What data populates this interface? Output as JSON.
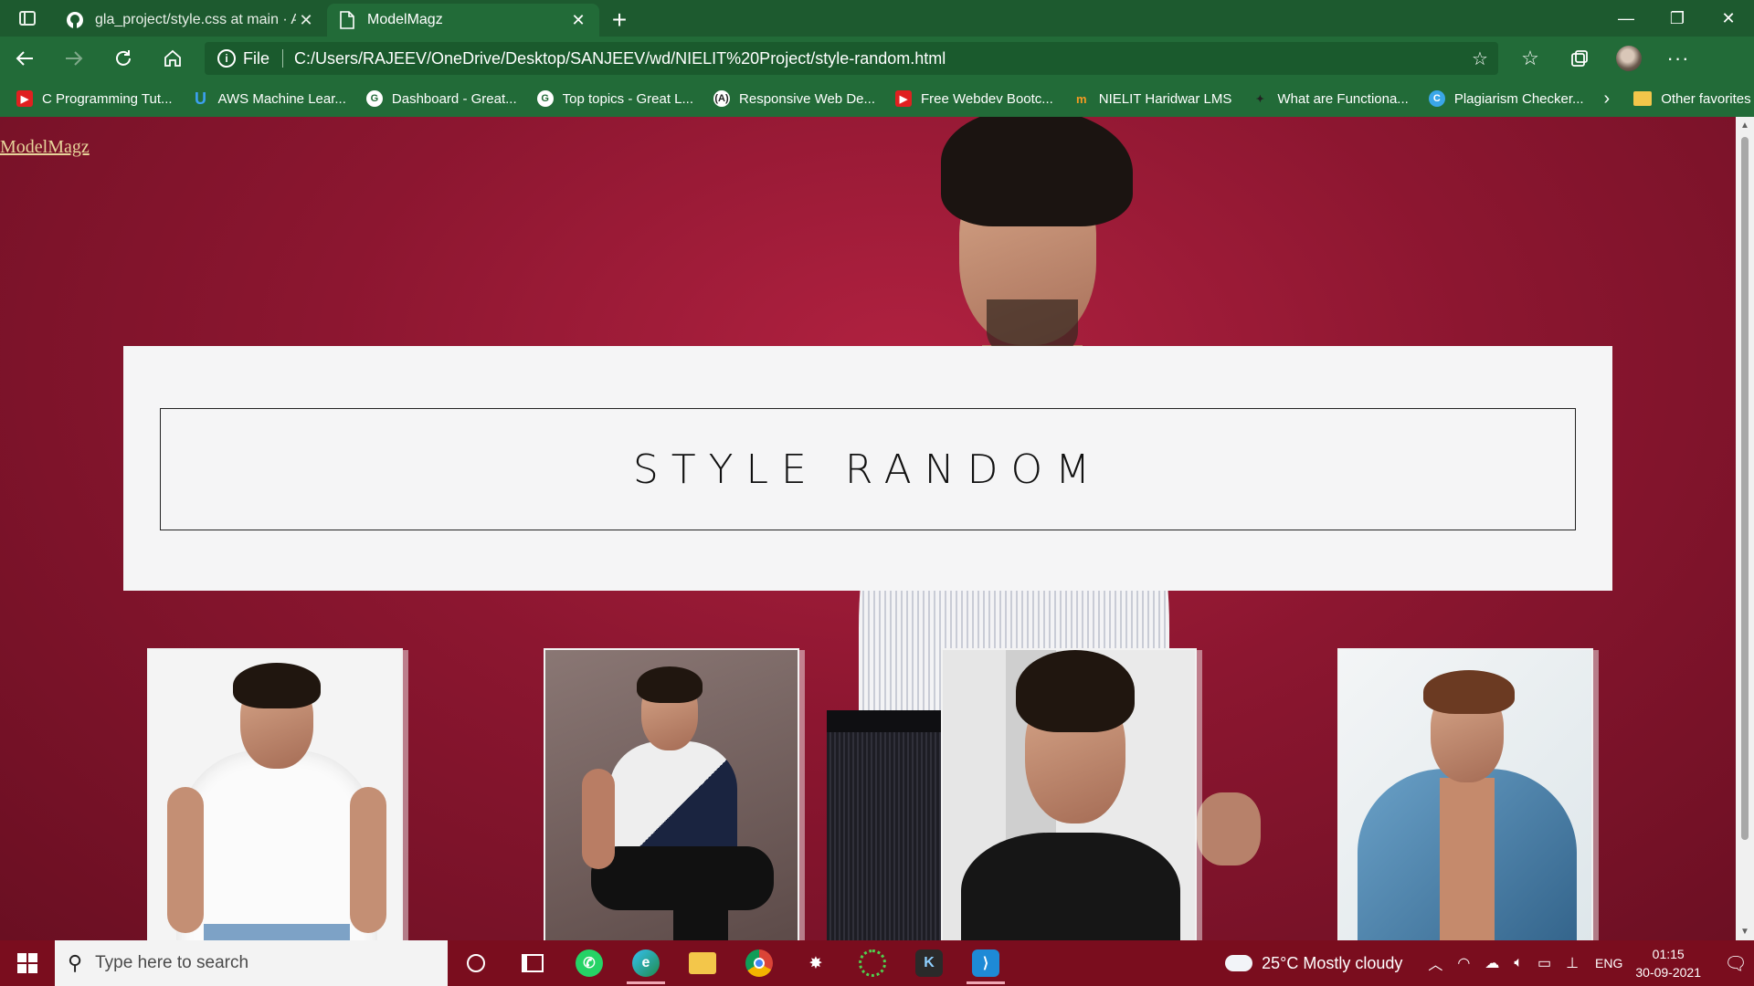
{
  "browser": {
    "tabs": [
      {
        "label": "gla_project/style.css at main · AM",
        "icon": "github-icon",
        "close": "✕"
      },
      {
        "label": "ModelMagz",
        "icon": "page-icon",
        "close": "✕"
      }
    ],
    "new_tab": "+",
    "window_controls": {
      "minimize": "—",
      "restore": "❐",
      "close": "✕"
    },
    "address": {
      "scheme_label": "File",
      "url": "C:/Users/RAJEEV/OneDrive/Desktop/SANJEEV/wd/NIELIT%20Project/style-random.html"
    },
    "favorites": [
      {
        "label": "C Programming Tut...",
        "icon": "youtube-icon"
      },
      {
        "label": "AWS Machine Lear...",
        "icon": "udemy-icon"
      },
      {
        "label": "Dashboard - Great...",
        "icon": "greatlearning-icon"
      },
      {
        "label": "Top topics - Great L...",
        "icon": "greatlearning-icon"
      },
      {
        "label": "Responsive Web De...",
        "icon": "freecodecamp-icon"
      },
      {
        "label": "Free Webdev Bootc...",
        "icon": "youtube-icon"
      },
      {
        "label": "NIELIT Haridwar LMS",
        "icon": "moodle-icon"
      },
      {
        "label": "What are Functiona...",
        "icon": "web-icon"
      },
      {
        "label": "Plagiarism Checker...",
        "icon": "plagiarism-icon"
      }
    ],
    "other_favorites": "Other favorites"
  },
  "page": {
    "site_link": "ModelMagz",
    "title": "STYLE RANDOM"
  },
  "taskbar": {
    "search_placeholder": "Type here to search",
    "weather": {
      "temp": "25°C",
      "condition": "Mostly cloudy"
    },
    "language": "ENG",
    "time": "01:15",
    "date": "30-09-2021"
  }
}
